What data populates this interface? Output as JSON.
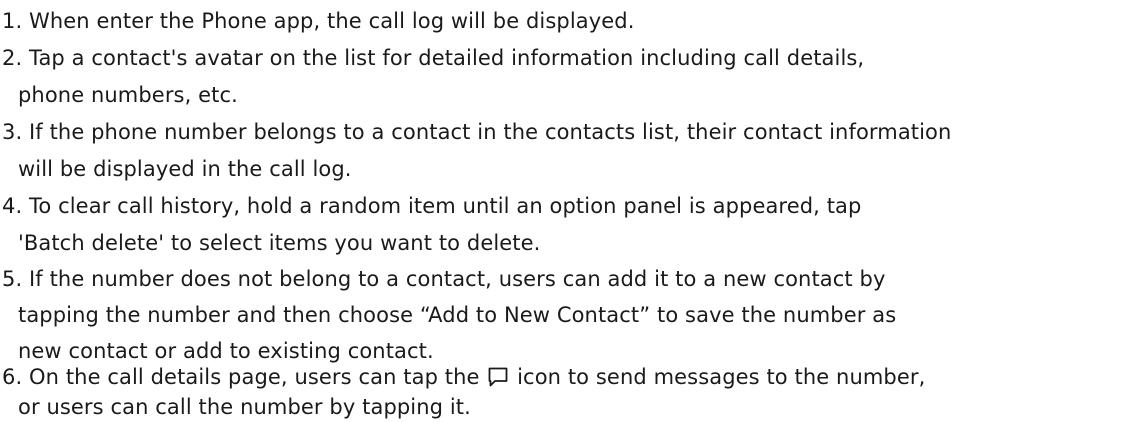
{
  "items": [
    {
      "lines": [
        "1. When enter the Phone app, the call log will be displayed."
      ]
    },
    {
      "lines": [
        "2. Tap a contact's avatar on the list for detailed information including call details,",
        "phone numbers, etc."
      ]
    },
    {
      "lines": [
        "3. If the phone number belongs to a contact in the contacts list, their contact information",
        "will be displayed in the call log."
      ]
    },
    {
      "lines": [
        "4. To clear call history, hold a random item until an option panel is appeared, tap",
        "'Batch delete' to select items you want to delete."
      ]
    },
    {
      "lines": [
        "5. If the number does not belong to a contact, users can add it to a new contact by",
        "tapping the number and then choose  “Add to New Contact”  to save the number as",
        "new contact or add to existing contact."
      ]
    },
    {
      "lines": [
        "6. On the call details page, users can tap the",
        "or users can call the number by tapping it."
      ],
      "icon": "message-icon",
      "after_icon": "icon to send messages to the number,"
    }
  ]
}
